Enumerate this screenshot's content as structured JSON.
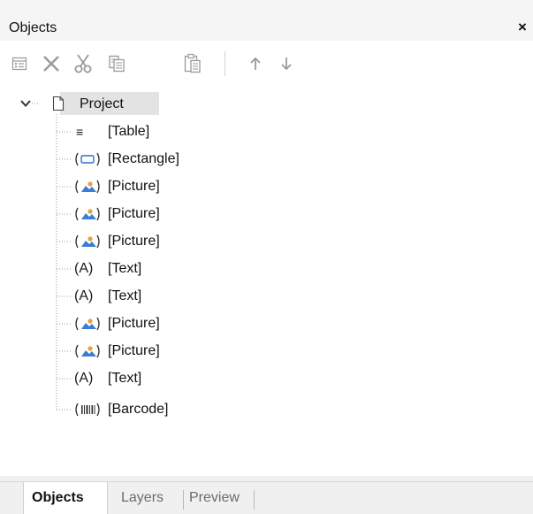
{
  "panel": {
    "title": "Objects",
    "close_icon": "close-icon",
    "close_glyph": "×"
  },
  "toolbar": {
    "buttons": [
      {
        "name": "properties-button",
        "icon": "properties-icon"
      },
      {
        "name": "delete-button",
        "icon": "delete-icon"
      },
      {
        "name": "cut-button",
        "icon": "cut-icon"
      },
      {
        "name": "copy-button",
        "icon": "copy-icon"
      },
      {
        "name": "paste-button",
        "icon": "paste-icon"
      },
      {
        "name": "move-up-button",
        "icon": "arrow-up-icon"
      },
      {
        "name": "move-down-button",
        "icon": "arrow-down-icon"
      }
    ],
    "disabled_color": "#9a9a9a"
  },
  "tree": {
    "root": {
      "label": "Project",
      "icon": "document-icon",
      "expanded": true
    },
    "children": [
      {
        "label": "[Table]",
        "icon": "table-icon",
        "glyph": "≡"
      },
      {
        "label": "[Rectangle]",
        "icon": "rectangle-icon",
        "glyph": "(▭)"
      },
      {
        "label": "[Picture]",
        "icon": "picture-icon",
        "glyph": ""
      },
      {
        "label": "[Picture]",
        "icon": "picture-icon",
        "glyph": ""
      },
      {
        "label": "[Picture]",
        "icon": "picture-icon",
        "glyph": ""
      },
      {
        "label": "[Text]",
        "icon": "text-icon",
        "glyph": "(A)"
      },
      {
        "label": "[Text]",
        "icon": "text-icon",
        "glyph": "(A)"
      },
      {
        "label": "[Picture]",
        "icon": "picture-icon",
        "glyph": ""
      },
      {
        "label": "[Picture]",
        "icon": "picture-icon",
        "glyph": ""
      },
      {
        "label": "[Text]",
        "icon": "text-icon",
        "glyph": "(A)"
      },
      {
        "label": "[Barcode]",
        "icon": "barcode-icon",
        "glyph": "(III)"
      }
    ]
  },
  "tabs": [
    {
      "label": "Objects",
      "active": true
    },
    {
      "label": "Layers",
      "active": false
    },
    {
      "label": "Preview",
      "active": false
    }
  ],
  "colors": {
    "picture_blue": "#3a7fd5",
    "picture_orange": "#e8a13a",
    "selection": "#e3e3e3"
  }
}
